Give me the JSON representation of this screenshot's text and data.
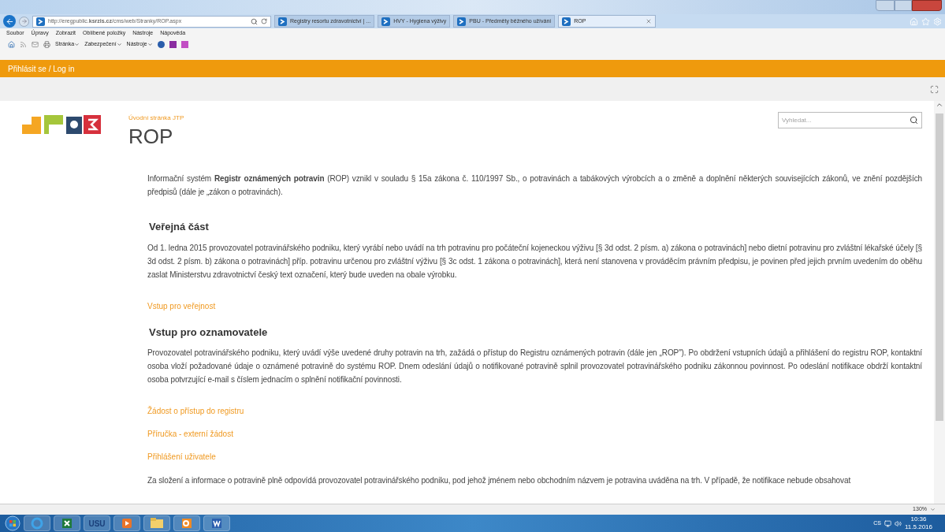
{
  "browser": {
    "address": "http://eregpublic.**ksrzis.cz**/cms/web/Stranky/ROP.aspx",
    "tabs": [
      {
        "label": "Registry resortu zdravotnictví | ...",
        "selected": false
      },
      {
        "label": "HVY - Hygiena výživy",
        "selected": false
      },
      {
        "label": "PBU - Předměty běžného užívání",
        "selected": false
      },
      {
        "label": "ROP",
        "selected": true
      }
    ],
    "menu": [
      "Soubor",
      "Úpravy",
      "Zobrazit",
      "Oblíbené položky",
      "Nástroje",
      "Nápověda"
    ],
    "commands": [
      "Stránka",
      "Zabezpečení",
      "Nástroje"
    ],
    "zoom": "130%"
  },
  "site_bar": {
    "login": "Přihlásit se / Log in"
  },
  "page": {
    "breadcrumb": "Úvodní stránka JTP",
    "title": "ROP",
    "search": {
      "placeholder": "Vyhledat..."
    },
    "blocks": [
      {
        "kind": "paragraph",
        "text": "Informační systém **Registr oznámených potravin** (ROP) vznikl v souladu § 15a zákona č. 110/1997 Sb., o potravinách a tabákových výrobcích a o změně a doplnění některých souvisejících zákonů, ve znění pozdějších předpisů (dále je „zákon o potravinách)."
      },
      {
        "kind": "heading",
        "text": "Veřejná část"
      },
      {
        "kind": "paragraph",
        "text": "Od 1. ledna 2015 provozovatel potravinářského podniku, který vyrábí nebo uvádí na trh potravinu pro počáteční kojeneckou výživu [§ 3d odst. 2 písm. a) zákona o potravinách] nebo dietní potravinu pro zvláštní lékařské účely [§ 3d odst. 2 písm. b) zákona o potravinách] příp. potravinu určenou pro zvláštní výživu [§ 3c odst. 1 zákona o potravinách], která není stanovena v prováděcím právním předpisu, je povinen před jejich prvním uvedením do oběhu zaslat Ministerstvu zdravotnictví český text označení, který bude uveden na obale výrobku."
      },
      {
        "kind": "link",
        "text": "Vstup pro veřejnost"
      },
      {
        "kind": "heading",
        "text": "Vstup pro oznamovatele"
      },
      {
        "kind": "paragraph",
        "text": "Provozovatel potravinářského podniku, který uvádí výše uvedené druhy potravin na trh, zažádá o přístup do Registru oznámených potravin (dále jen „ROP\"). Po obdržení vstupních údajů a přihlášení do registru ROP, kontaktní osoba vloží požadované údaje o oznámené potravině do systému ROP. Dnem odeslání údajů o notifikované potravině splnil provozovatel potravinářského podniku zákonnou povinnost. Po odeslání notifikace obdrží kontaktní osoba potvrzující e-mail s číslem jednacím o splnění notifikační povinnosti."
      },
      {
        "kind": "link",
        "text": "Žádost o přístup do registru"
      },
      {
        "kind": "link",
        "text": "Příručka - externí žádost"
      },
      {
        "kind": "link",
        "text": "Přihlášení uživatele"
      },
      {
        "kind": "paragraph",
        "text": "Za složení a informace o potravině plně odpovídá provozovatel potravinářského podniku, pod jehož jménem nebo obchodním názvem je potravina uváděna na trh. V případě, že notifikace nebude obsahovat"
      }
    ]
  },
  "taskbar": {
    "apps": [
      {
        "kind": "ie"
      },
      {
        "kind": "excel"
      },
      {
        "kind": "label",
        "text": "USU"
      },
      {
        "kind": "media"
      },
      {
        "kind": "folder"
      },
      {
        "kind": "outlook"
      },
      {
        "kind": "word"
      }
    ],
    "language": "CS",
    "time": "10:36",
    "date": "11.5.2016"
  }
}
